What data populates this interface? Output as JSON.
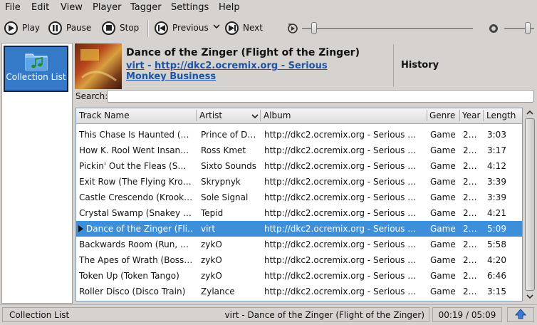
{
  "menu": {
    "file": "File",
    "edit": "Edit",
    "view": "View",
    "player": "Player",
    "tagger": "Tagger",
    "settings": "Settings",
    "help": "Help"
  },
  "toolbar": {
    "play": "Play",
    "pause": "Pause",
    "stop": "Stop",
    "previous": "Previous",
    "next": "Next"
  },
  "sidebar": {
    "collection_list": "Collection List"
  },
  "now_playing": {
    "title": "Dance of the Zinger (Flight of the Zinger)",
    "artist": "virt",
    "separator": " - ",
    "album": "http://dkc2.ocremix.org - Serious Monkey Business"
  },
  "history_label": "History",
  "search": {
    "label": "Search:",
    "value": ""
  },
  "table": {
    "headers": [
      "Track Name",
      "Artist",
      "Album",
      "Genre",
      "Year",
      "Length"
    ],
    "rows": [
      [
        "This Chase Is Haunted (…",
        "Prince of D…",
        "http://dkc2.ocremix.org - Serious …",
        "Game",
        "2…",
        "3:03"
      ],
      [
        "How K. Rool Went Insan…",
        "Ross Kmet",
        "http://dkc2.ocremix.org - Serious …",
        "Game",
        "2…",
        "3:17"
      ],
      [
        "Pickin' Out the Fleas (S…",
        "Sixto Sounds",
        "http://dkc2.ocremix.org - Serious …",
        "Game",
        "2…",
        "4:12"
      ],
      [
        "Exit Row (The Flying Kro…",
        "Skrypnyk",
        "http://dkc2.ocremix.org - Serious …",
        "Game",
        "2…",
        "3:39"
      ],
      [
        "Castle Crescendo (Krook…",
        "Sole Signal",
        "http://dkc2.ocremix.org - Serious …",
        "Game",
        "2…",
        "3:39"
      ],
      [
        "Crystal Swamp (Snakey …",
        "Tepid",
        "http://dkc2.ocremix.org - Serious …",
        "Game",
        "2…",
        "4:21"
      ],
      [
        "Dance of the Zinger (Fli…",
        "virt",
        "http://dkc2.ocremix.org - Serious …",
        "Game",
        "2…",
        "5:09"
      ],
      [
        "Backwards Room (Run, …",
        "zykO",
        "http://dkc2.ocremix.org - Serious …",
        "Game",
        "2…",
        "5:58"
      ],
      [
        "The Apes of Wrath (Boss…",
        "zykO",
        "http://dkc2.ocremix.org - Serious …",
        "Game",
        "2…",
        "4:20"
      ],
      [
        "Token Up (Token Tango)",
        "zykO",
        "http://dkc2.ocremix.org - Serious …",
        "Game",
        "2…",
        "6:46"
      ],
      [
        "Roller Disco (Disco Train)",
        "Zylance",
        "http://dkc2.ocremix.org - Serious …",
        "Game",
        "2…",
        "3:15"
      ]
    ],
    "selected_row": 6
  },
  "status": {
    "left": "Collection List",
    "now_playing": "virt - Dance of the Zinger (Flight of the Zinger)",
    "time": "00:19 / 05:09"
  },
  "colors": {
    "selection": "#3c8fd8",
    "link": "#1d55a6",
    "collection_button": "#3579c9"
  }
}
